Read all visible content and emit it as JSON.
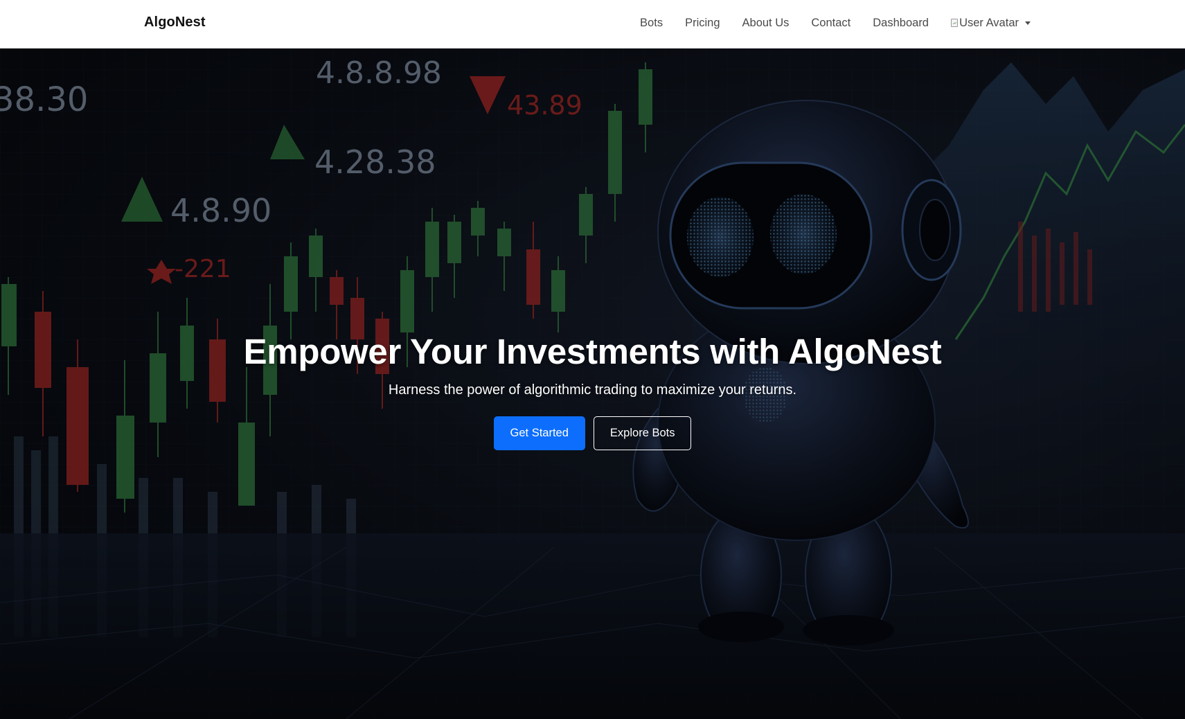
{
  "navbar": {
    "brand": "AlgoNest",
    "links": [
      "Bots",
      "Pricing",
      "About Us",
      "Contact",
      "Dashboard"
    ],
    "avatar_alt": "User Avatar"
  },
  "hero": {
    "title": "Empower Your Investments with AlgoNest",
    "subtitle": "Harness the power of algorithmic trading to maximize your returns.",
    "primary_button": "Get Started",
    "secondary_button": "Explore Bots",
    "background_labels": [
      "38.30",
      "4.8.8.98",
      "43.89",
      "4.28.38",
      "4.8.90",
      "-221"
    ]
  },
  "colors": {
    "primary": "#0d6efd",
    "navbar_bg": "#ffffff",
    "hero_text": "#ffffff",
    "candle_up": "#3f9a4f",
    "candle_down": "#c9302c"
  },
  "icons": [
    "broken-image-icon",
    "caret-down-icon"
  ]
}
